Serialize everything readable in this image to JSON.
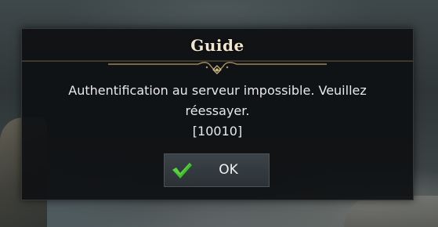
{
  "dialog": {
    "title": "Guide",
    "message_lines": [
      "Authentification au serveur impossible. Veuillez",
      "réessayer.",
      "[10010]"
    ],
    "ok_button": {
      "label": "OK",
      "icon": "check-icon"
    }
  },
  "colors": {
    "ornament_gold": "#b49a63",
    "check_green": "#3fbf2a",
    "title_text": "#f0e6d0"
  }
}
